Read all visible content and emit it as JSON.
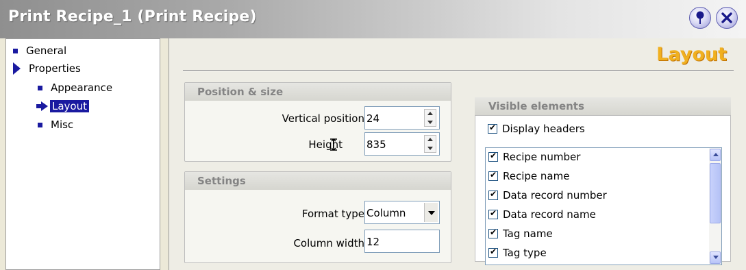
{
  "window": {
    "title": "Print Recipe_1 (Print Recipe)"
  },
  "tree": {
    "items": [
      {
        "label": "General"
      },
      {
        "label": "Properties"
      },
      {
        "label": "Appearance"
      },
      {
        "label": "Layout"
      },
      {
        "label": "Misc"
      }
    ]
  },
  "main": {
    "heading": "Layout",
    "position_size": {
      "title": "Position & size",
      "vertical_position_label": "Vertical position",
      "vertical_position_value": "24",
      "height_label": "Height",
      "height_value": "835"
    },
    "settings": {
      "title": "Settings",
      "format_type_label": "Format type",
      "format_type_value": "Column",
      "column_width_label": "Column width",
      "column_width_value": "12"
    },
    "visible_elements": {
      "title": "Visible elements",
      "display_headers_label": "Display headers",
      "items": [
        "Recipe number",
        "Recipe name",
        "Data record number",
        "Data record name",
        "Tag name",
        "Tag type"
      ]
    }
  }
}
